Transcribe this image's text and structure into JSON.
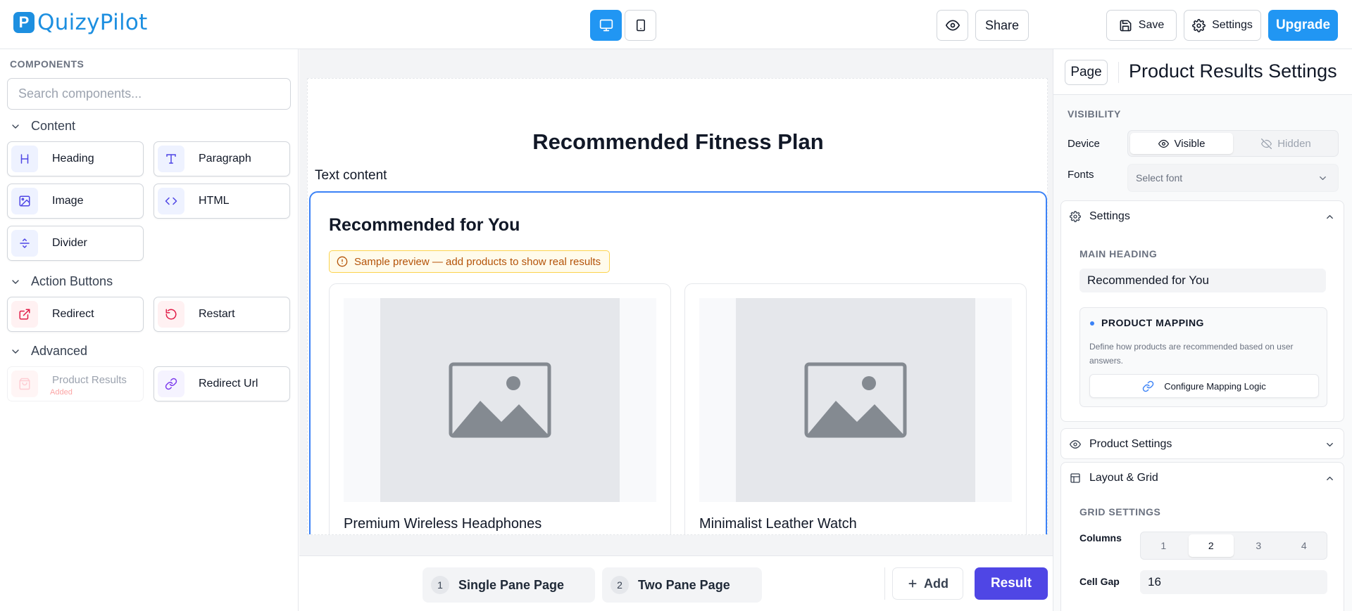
{
  "app": {
    "logo_letter": "P",
    "name": "QuizyPilot"
  },
  "toolbar": {
    "desktop_icon": "monitor-icon",
    "mobile_icon": "smartphone-icon",
    "preview_icon": "eye-icon",
    "share_label": "Share",
    "save_label": "Save",
    "settings_label": "Settings",
    "upgrade_label": "Upgrade"
  },
  "sidebar": {
    "title": "COMPONENTS",
    "search_placeholder": "Search components...",
    "sections": {
      "content": {
        "label": "Content",
        "items": [
          {
            "label": "Heading",
            "icon": "heading-icon"
          },
          {
            "label": "Paragraph",
            "icon": "text-icon"
          },
          {
            "label": "Image",
            "icon": "image-icon"
          },
          {
            "label": "HTML",
            "icon": "code-icon"
          },
          {
            "label": "Divider",
            "icon": "divider-icon"
          }
        ]
      },
      "action": {
        "label": "Action Buttons",
        "items": [
          {
            "label": "Redirect",
            "icon": "external-link-icon"
          },
          {
            "label": "Restart",
            "icon": "restart-icon"
          }
        ]
      },
      "advanced": {
        "label": "Advanced",
        "items": [
          {
            "label": "Product Results",
            "sub": "Added",
            "icon": "shopping-bag-icon"
          },
          {
            "label": "Redirect Url",
            "icon": "link-icon"
          }
        ]
      }
    }
  },
  "canvas": {
    "page_title": "Recommended Fitness Plan",
    "text_content": "Text content",
    "results": {
      "heading": "Recommended for You",
      "notice": "Sample preview — add products to show real results",
      "products": [
        {
          "name": "Premium Wireless Headphones"
        },
        {
          "name": "Minimalist Leather Watch"
        }
      ]
    }
  },
  "bottom": {
    "pages": [
      {
        "num": "1",
        "label": "Single Pane Page"
      },
      {
        "num": "2",
        "label": "Two Pane Page"
      }
    ],
    "add_label": "Add",
    "result_label": "Result"
  },
  "panel": {
    "page_label": "Page",
    "title": "Product Results Settings",
    "visibility": {
      "label": "VISIBILITY",
      "device_label": "Device",
      "visible_label": "Visible",
      "hidden_label": "Hidden",
      "fonts_label": "Fonts",
      "fonts_placeholder": "Select font"
    },
    "settings": {
      "label": "Settings",
      "main_heading_label": "MAIN HEADING",
      "main_heading_value": "Recommended for You",
      "mapping": {
        "title": "PRODUCT MAPPING",
        "desc": "Define how products are recommended based on user answers.",
        "button": "Configure Mapping Logic"
      }
    },
    "product_settings_label": "Product Settings",
    "layout": {
      "label": "Layout & Grid",
      "grid_label": "GRID SETTINGS",
      "columns_label": "Columns",
      "columns": [
        "1",
        "2",
        "3",
        "4"
      ],
      "columns_selected": "2",
      "cell_gap_label": "Cell Gap",
      "cell_gap_value": "16"
    }
  },
  "colors": {
    "brand": "#1d8fe0",
    "primary": "#2196f3",
    "indigo": "#4f46e5",
    "selection": "#3b82f6",
    "warning_text": "#b45309"
  }
}
